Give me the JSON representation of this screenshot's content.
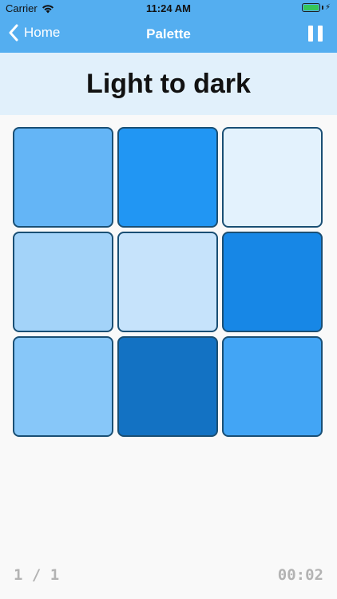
{
  "status_bar": {
    "carrier": "Carrier",
    "time": "11:24 AM",
    "wifi_icon": "wifi-icon",
    "battery_icon": "battery-icon",
    "battery_level": 1.0,
    "battery_color": "#35c659",
    "charging_icon": "bolt-icon"
  },
  "nav": {
    "back_icon": "chevron-left-icon",
    "back_label": "Home",
    "title": "Palette",
    "pause_icon": "pause-icon",
    "bar_color": "#54aef0"
  },
  "puzzle": {
    "heading": "Light to dark",
    "band_color": "#e1f0fb",
    "tiles": [
      {
        "color": "#64b5f6"
      },
      {
        "color": "#2196f3"
      },
      {
        "color": "#e3f2fd"
      },
      {
        "color": "#a3d3f9"
      },
      {
        "color": "#c6e3fb"
      },
      {
        "color": "#1787e6"
      },
      {
        "color": "#87c7f9"
      },
      {
        "color": "#1372c3"
      },
      {
        "color": "#42a5f5"
      }
    ]
  },
  "footer": {
    "progress": "1 / 1",
    "timer": "00:02"
  }
}
